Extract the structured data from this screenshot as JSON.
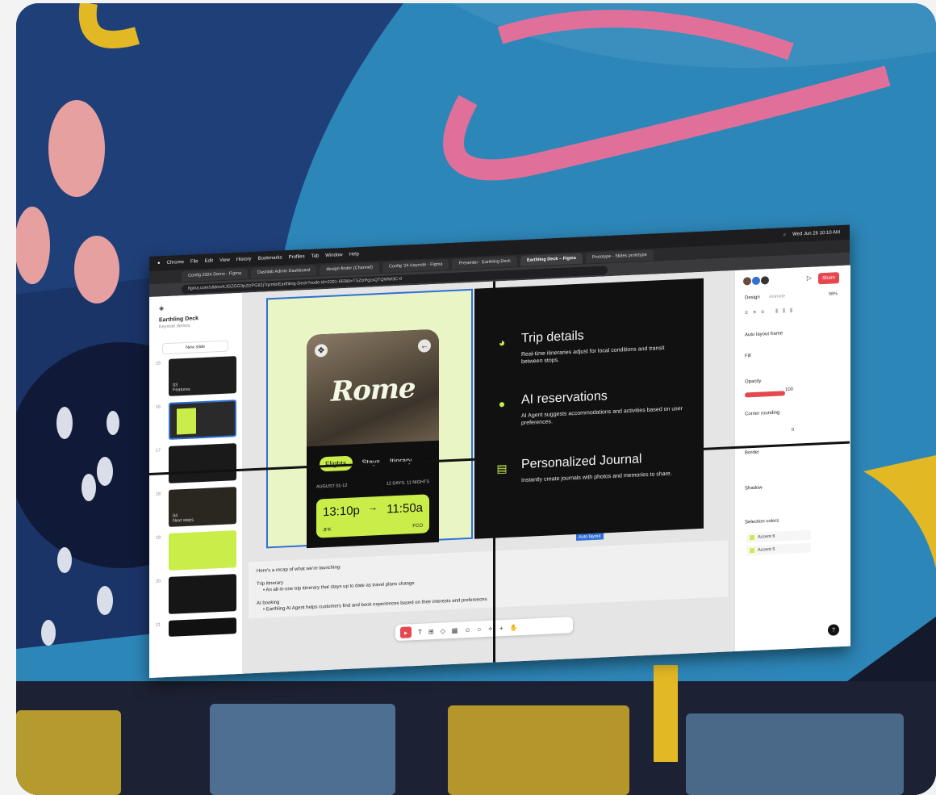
{
  "browser": {
    "menubar": [
      "Chrome",
      "File",
      "Edit",
      "View",
      "History",
      "Bookmarks",
      "Profiles",
      "Tab",
      "Window",
      "Help"
    ],
    "clock": "Wed Jun 26 10:10 AM",
    "tabs": [
      {
        "label": "Config 2024 Demo - Figma"
      },
      {
        "label": "Dashlab Admin Dashboard"
      },
      {
        "label": "design-finder (Channel)"
      },
      {
        "label": "Config '24 Keynote - Figma"
      },
      {
        "label": "Presenter · Earthling Deck"
      },
      {
        "label": "Earthling Deck – Figma",
        "active": true
      },
      {
        "label": "Prototype - Slides prototype"
      }
    ],
    "url": "figma.com/slides/KJGZGG3p2tzPG92j7qzmb/Earthling-Deck?node-id=2291-660&t=TSZlzPgzxQTQWW3C-0"
  },
  "figma": {
    "document_title": "Earthling Deck",
    "document_subtitle": "Keynote demos",
    "new_slide_label": "New slide",
    "slides": [
      {
        "num": "15",
        "text": "03\nFeatures",
        "color": "#1e1e1e"
      },
      {
        "num": "16",
        "text": "",
        "color": "#2a2a2a"
      },
      {
        "num": "17",
        "text": "",
        "color": "#1a1a1a"
      },
      {
        "num": "18",
        "text": "04\nNext steps",
        "color": "#2a2620"
      },
      {
        "num": "19",
        "text": "",
        "color": "#c9ee4a"
      },
      {
        "num": "20",
        "text": "",
        "color": "#161616"
      },
      {
        "num": "21",
        "text": "",
        "color": "#111111"
      }
    ],
    "phone": {
      "title": "Rome",
      "tabs": [
        "Flights",
        "Stays",
        "Itinrary"
      ],
      "active_tab": "Flights",
      "dates": "AUGUST 01-12",
      "duration": "12 DAYS, 11 NIGHTS",
      "depart_time": "13:10p",
      "arrive_time": "11:50a",
      "from": "JFK",
      "to": "FCO"
    },
    "features": [
      {
        "icon": "globe-icon",
        "title": "Trip details",
        "desc": "Real-time itineraries adjust for local conditions and transit between stops."
      },
      {
        "icon": "person-icon",
        "title": "AI reservations",
        "desc": "AI Agent suggests accommodations and activities based on user preferences."
      },
      {
        "icon": "journal-icon",
        "title": "Personalized Journal",
        "desc": "Instantly create journals with photos and memories to share."
      }
    ],
    "autolayout_tag": "Auto layout",
    "notes": {
      "intro": "Here's a recap of what we're launching:",
      "item1_title": "Trip itinerary",
      "item1_text": "• An all-in-one trip itinerary that stays up to date as travel plans change",
      "item2_title": "AI booking",
      "item2_text": "• Earthling AI Agent helps customers find and book experiences based on their interests and preferences"
    },
    "right_panel": {
      "share_label": "Share",
      "tabs": [
        "Design",
        "Animate"
      ],
      "zoom": "58%",
      "auto_layout_frame": "Auto layout frame",
      "fill_label": "Fill",
      "opacity_label": "Opacity",
      "opacity_value": "100",
      "corner_label": "Corner rounding",
      "corner_value": "0",
      "border_label": "Border",
      "shadow_label": "Shadow",
      "selection_colors_label": "Selection colors",
      "colors": [
        "Accent 6",
        "Accent 5"
      ]
    }
  },
  "colors": {
    "accent": "#c9ee4a",
    "share": "#e5484d",
    "selection": "#2f6fd6"
  }
}
